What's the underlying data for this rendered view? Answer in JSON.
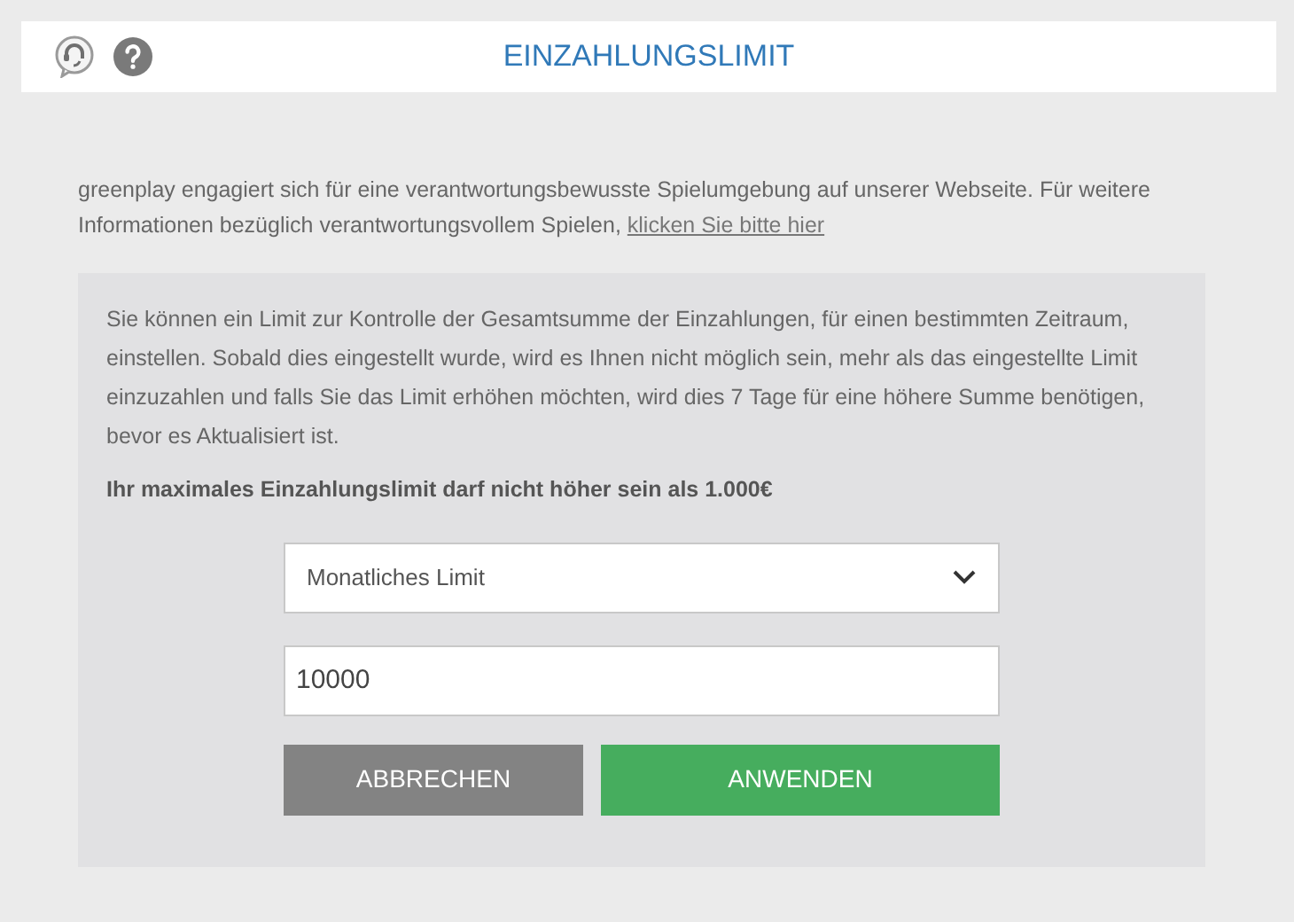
{
  "header": {
    "title": "EINZAHLUNGSLIMIT"
  },
  "intro": {
    "text": "greenplay engagiert sich für eine verantwortungsbewusste Spielumgebung auf unserer Webseite. Für weitere Informationen bezüglich verantwortungsvollem Spielen,",
    "link": "klicken Sie bitte hier"
  },
  "panel": {
    "description": "Sie können ein Limit zur Kontrolle der Gesamtsumme der Einzahlungen, für einen bestimmten Zeitraum, einstellen. Sobald dies eingestellt wurde, wird es Ihnen nicht möglich sein, mehr als das eingestellte Limit einzuzahlen und falls Sie das Limit erhöhen möchten, wird dies 7 Tage für eine höhere Summe benötigen, bevor es Aktualisiert ist.",
    "notice": "Ihr maximales Einzahlungslimit darf nicht höher sein als 1.000€",
    "period_select": {
      "value": "Monatliches Limit"
    },
    "amount_field": {
      "value": "10000"
    },
    "buttons": [
      {
        "label": "ABBRECHEN",
        "kind": "cancel"
      },
      {
        "label": "ANWENDEN",
        "kind": "apply"
      }
    ]
  }
}
